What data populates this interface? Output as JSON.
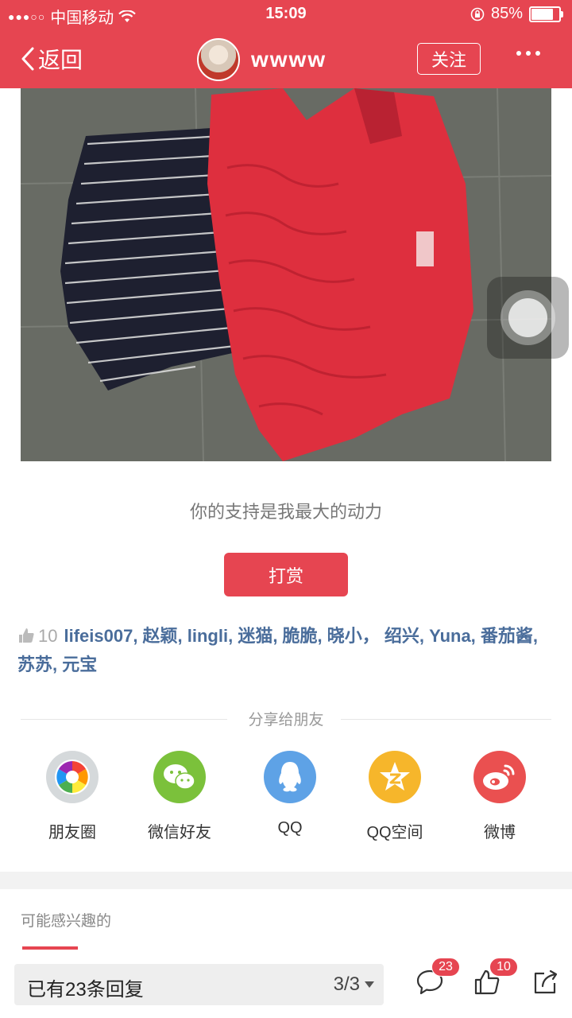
{
  "status_bar": {
    "carrier": "中国移动",
    "time": "15:09",
    "battery": "85%",
    "battery_level": 0.85
  },
  "nav": {
    "back_label": "返回",
    "username": "wwww",
    "follow_label": "关注"
  },
  "post": {
    "support_text": "你的支持是我最大的动力",
    "reward_label": "打赏"
  },
  "likes": {
    "count": "10",
    "names": "lifeis007, 赵颖, lingli, 迷猫, 脆脆, 晓小， 绍兴, Yuna, 番茄酱, 苏苏, 元宝"
  },
  "share": {
    "title": "分享给朋友",
    "items": [
      {
        "label": "朋友圈",
        "icon": "moments-icon",
        "color": "#d5d9db"
      },
      {
        "label": "微信好友",
        "icon": "wechat-icon",
        "color": "#7bc13b"
      },
      {
        "label": "QQ",
        "icon": "qq-icon",
        "color": "#5ea2e6"
      },
      {
        "label": "QQ空间",
        "icon": "qzone-icon",
        "color": "#f6b62b"
      },
      {
        "label": "微博",
        "icon": "weibo-icon",
        "color": "#ea5050"
      }
    ]
  },
  "related": {
    "title": "可能感兴趣的"
  },
  "bottom": {
    "reply_text": "已有23条回复",
    "page": "3/3",
    "comment_badge": "23",
    "like_badge": "10"
  },
  "colors": {
    "brand": "#e64551",
    "name_link": "#4a6d9b"
  }
}
